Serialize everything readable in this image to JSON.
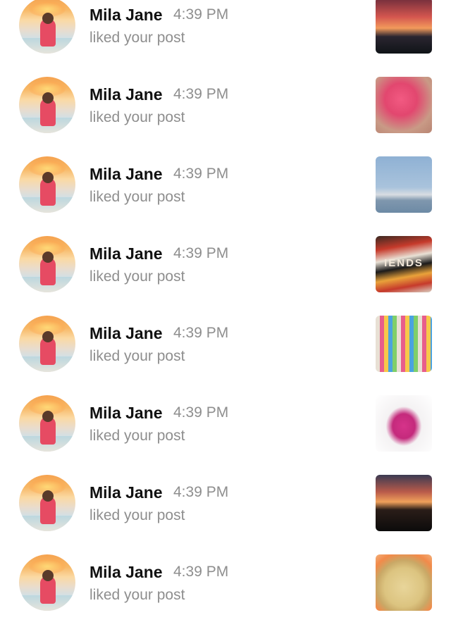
{
  "notifications": [
    {
      "name": "Mila Jane",
      "time": "4:39 PM",
      "action": "liked your post",
      "thumb": "sunset-car-dashboard-photo"
    },
    {
      "name": "Mila Jane",
      "time": "4:39 PM",
      "action": "liked your post",
      "thumb": "pink-nails-photo"
    },
    {
      "name": "Mila Jane",
      "time": "4:39 PM",
      "action": "liked your post",
      "thumb": "statue-of-liberty-photo"
    },
    {
      "name": "Mila Jane",
      "time": "4:39 PM",
      "action": "liked your post",
      "thumb": "friends-sign-photo",
      "thumb_text": "IENDS"
    },
    {
      "name": "Mila Jane",
      "time": "4:39 PM",
      "action": "liked your post",
      "thumb": "colorful-jars-photo"
    },
    {
      "name": "Mila Jane",
      "time": "4:39 PM",
      "action": "liked your post",
      "thumb": "pink-dress-photo"
    },
    {
      "name": "Mila Jane",
      "time": "4:39 PM",
      "action": "liked your post",
      "thumb": "tree-sunset-photo"
    },
    {
      "name": "Mila Jane",
      "time": "4:39 PM",
      "action": "liked your post",
      "thumb": "pie-photo"
    }
  ],
  "colors": {
    "name_text": "#111111",
    "secondary_text": "#8e8e8e",
    "background": "#ffffff"
  }
}
